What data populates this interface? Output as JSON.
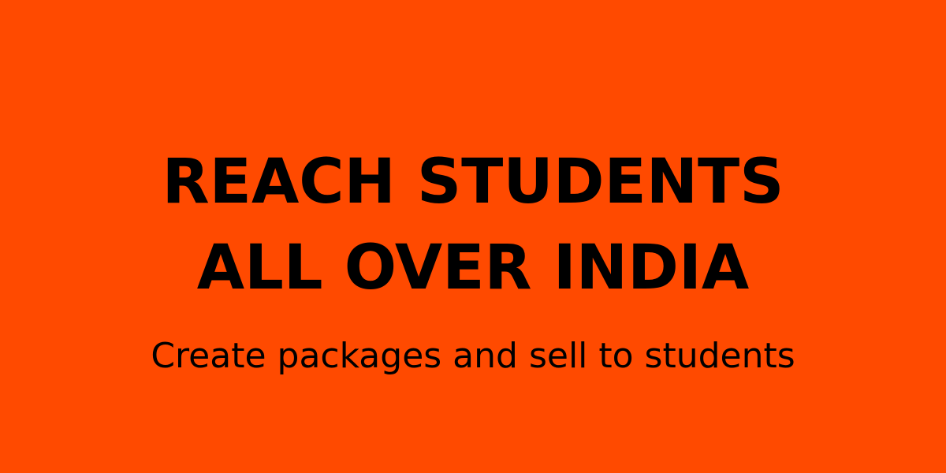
{
  "banner": {
    "headline_line1": "REACH STUDENTS",
    "headline_line2": "ALL OVER INDIA",
    "subheadline": "Create packages and sell to students"
  },
  "colors": {
    "background": "#ff4a00",
    "text": "#000000"
  }
}
